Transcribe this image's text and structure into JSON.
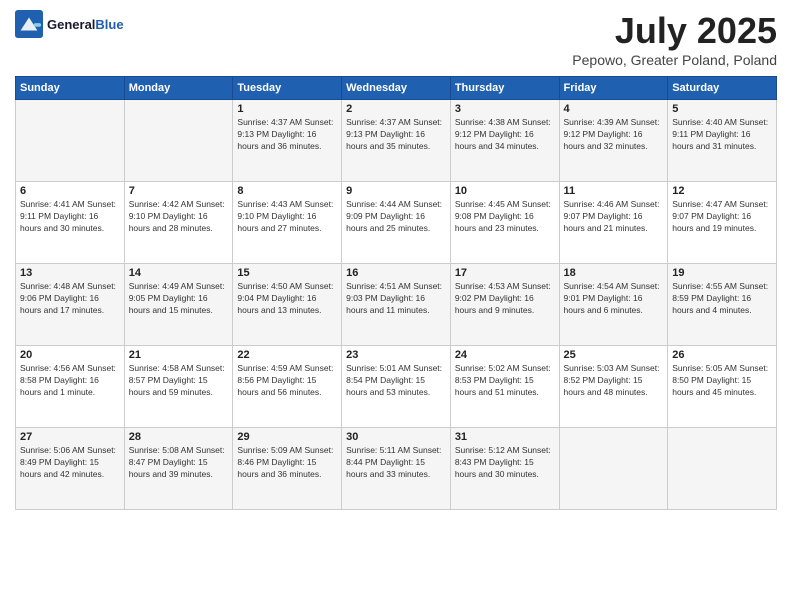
{
  "header": {
    "logo_general": "General",
    "logo_blue": "Blue",
    "title": "July 2025",
    "subtitle": "Pepowo, Greater Poland, Poland"
  },
  "columns": [
    "Sunday",
    "Monday",
    "Tuesday",
    "Wednesday",
    "Thursday",
    "Friday",
    "Saturday"
  ],
  "weeks": [
    [
      {
        "num": "",
        "info": ""
      },
      {
        "num": "",
        "info": ""
      },
      {
        "num": "1",
        "info": "Sunrise: 4:37 AM\nSunset: 9:13 PM\nDaylight: 16 hours\nand 36 minutes."
      },
      {
        "num": "2",
        "info": "Sunrise: 4:37 AM\nSunset: 9:13 PM\nDaylight: 16 hours\nand 35 minutes."
      },
      {
        "num": "3",
        "info": "Sunrise: 4:38 AM\nSunset: 9:12 PM\nDaylight: 16 hours\nand 34 minutes."
      },
      {
        "num": "4",
        "info": "Sunrise: 4:39 AM\nSunset: 9:12 PM\nDaylight: 16 hours\nand 32 minutes."
      },
      {
        "num": "5",
        "info": "Sunrise: 4:40 AM\nSunset: 9:11 PM\nDaylight: 16 hours\nand 31 minutes."
      }
    ],
    [
      {
        "num": "6",
        "info": "Sunrise: 4:41 AM\nSunset: 9:11 PM\nDaylight: 16 hours\nand 30 minutes."
      },
      {
        "num": "7",
        "info": "Sunrise: 4:42 AM\nSunset: 9:10 PM\nDaylight: 16 hours\nand 28 minutes."
      },
      {
        "num": "8",
        "info": "Sunrise: 4:43 AM\nSunset: 9:10 PM\nDaylight: 16 hours\nand 27 minutes."
      },
      {
        "num": "9",
        "info": "Sunrise: 4:44 AM\nSunset: 9:09 PM\nDaylight: 16 hours\nand 25 minutes."
      },
      {
        "num": "10",
        "info": "Sunrise: 4:45 AM\nSunset: 9:08 PM\nDaylight: 16 hours\nand 23 minutes."
      },
      {
        "num": "11",
        "info": "Sunrise: 4:46 AM\nSunset: 9:07 PM\nDaylight: 16 hours\nand 21 minutes."
      },
      {
        "num": "12",
        "info": "Sunrise: 4:47 AM\nSunset: 9:07 PM\nDaylight: 16 hours\nand 19 minutes."
      }
    ],
    [
      {
        "num": "13",
        "info": "Sunrise: 4:48 AM\nSunset: 9:06 PM\nDaylight: 16 hours\nand 17 minutes."
      },
      {
        "num": "14",
        "info": "Sunrise: 4:49 AM\nSunset: 9:05 PM\nDaylight: 16 hours\nand 15 minutes."
      },
      {
        "num": "15",
        "info": "Sunrise: 4:50 AM\nSunset: 9:04 PM\nDaylight: 16 hours\nand 13 minutes."
      },
      {
        "num": "16",
        "info": "Sunrise: 4:51 AM\nSunset: 9:03 PM\nDaylight: 16 hours\nand 11 minutes."
      },
      {
        "num": "17",
        "info": "Sunrise: 4:53 AM\nSunset: 9:02 PM\nDaylight: 16 hours\nand 9 minutes."
      },
      {
        "num": "18",
        "info": "Sunrise: 4:54 AM\nSunset: 9:01 PM\nDaylight: 16 hours\nand 6 minutes."
      },
      {
        "num": "19",
        "info": "Sunrise: 4:55 AM\nSunset: 8:59 PM\nDaylight: 16 hours\nand 4 minutes."
      }
    ],
    [
      {
        "num": "20",
        "info": "Sunrise: 4:56 AM\nSunset: 8:58 PM\nDaylight: 16 hours\nand 1 minute."
      },
      {
        "num": "21",
        "info": "Sunrise: 4:58 AM\nSunset: 8:57 PM\nDaylight: 15 hours\nand 59 minutes."
      },
      {
        "num": "22",
        "info": "Sunrise: 4:59 AM\nSunset: 8:56 PM\nDaylight: 15 hours\nand 56 minutes."
      },
      {
        "num": "23",
        "info": "Sunrise: 5:01 AM\nSunset: 8:54 PM\nDaylight: 15 hours\nand 53 minutes."
      },
      {
        "num": "24",
        "info": "Sunrise: 5:02 AM\nSunset: 8:53 PM\nDaylight: 15 hours\nand 51 minutes."
      },
      {
        "num": "25",
        "info": "Sunrise: 5:03 AM\nSunset: 8:52 PM\nDaylight: 15 hours\nand 48 minutes."
      },
      {
        "num": "26",
        "info": "Sunrise: 5:05 AM\nSunset: 8:50 PM\nDaylight: 15 hours\nand 45 minutes."
      }
    ],
    [
      {
        "num": "27",
        "info": "Sunrise: 5:06 AM\nSunset: 8:49 PM\nDaylight: 15 hours\nand 42 minutes."
      },
      {
        "num": "28",
        "info": "Sunrise: 5:08 AM\nSunset: 8:47 PM\nDaylight: 15 hours\nand 39 minutes."
      },
      {
        "num": "29",
        "info": "Sunrise: 5:09 AM\nSunset: 8:46 PM\nDaylight: 15 hours\nand 36 minutes."
      },
      {
        "num": "30",
        "info": "Sunrise: 5:11 AM\nSunset: 8:44 PM\nDaylight: 15 hours\nand 33 minutes."
      },
      {
        "num": "31",
        "info": "Sunrise: 5:12 AM\nSunset: 8:43 PM\nDaylight: 15 hours\nand 30 minutes."
      },
      {
        "num": "",
        "info": ""
      },
      {
        "num": "",
        "info": ""
      }
    ]
  ]
}
